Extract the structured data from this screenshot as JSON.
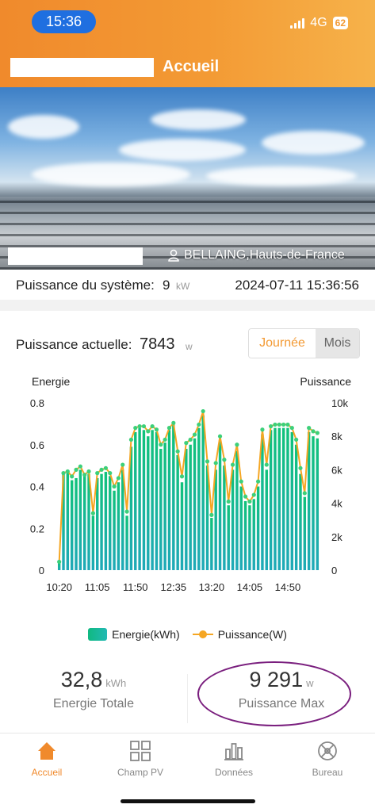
{
  "status_bar": {
    "time": "15:36",
    "network": "4G",
    "battery": "62"
  },
  "header": {
    "title": "Accueil"
  },
  "banner": {
    "location": "BELLAING,Hauts-de-France"
  },
  "system": {
    "label": "Puissance du système:",
    "value": "9",
    "unit": "kW",
    "datetime": "2024-07-11 15:36:56"
  },
  "current": {
    "label": "Puissance actuelle:",
    "value": "7843",
    "unit": "w"
  },
  "period_toggle": {
    "day": "Journée",
    "month": "Mois",
    "selected": "Journée"
  },
  "chart_data": {
    "type": "bar",
    "combo": "bar+line",
    "left_axis_title": "Energie",
    "right_axis_title": "Puissance",
    "left_ticks": [
      "0",
      "0.2",
      "0.4",
      "0.6",
      "0.8"
    ],
    "right_ticks": [
      "0",
      "2k",
      "4k",
      "6k",
      "8k",
      "10k"
    ],
    "left_ylim": [
      0,
      0.8
    ],
    "right_ylim": [
      0,
      10000
    ],
    "x_ticks": [
      "10:20",
      "11:05",
      "11:50",
      "12:35",
      "13:20",
      "14:05",
      "14:50"
    ],
    "series": [
      {
        "name": "Energie(kWh)",
        "axis": "left",
        "color": "#14b8a6",
        "values": [
          0.04,
          0.46,
          0.47,
          0.43,
          0.44,
          0.48,
          0.45,
          0.46,
          0.26,
          0.44,
          0.46,
          0.47,
          0.45,
          0.38,
          0.42,
          0.48,
          0.26,
          0.59,
          0.66,
          0.68,
          0.67,
          0.64,
          0.67,
          0.66,
          0.58,
          0.61,
          0.67,
          0.7,
          0.55,
          0.42,
          0.58,
          0.6,
          0.63,
          0.68,
          0.74,
          0.5,
          0.25,
          0.48,
          0.62,
          0.5,
          0.31,
          0.48,
          0.57,
          0.4,
          0.33,
          0.31,
          0.34,
          0.4,
          0.65,
          0.48,
          0.67,
          0.68,
          0.68,
          0.68,
          0.68,
          0.66,
          0.6,
          0.46,
          0.35,
          0.66,
          0.64,
          0.63
        ]
      },
      {
        "name": "Puissance(W)",
        "axis": "right",
        "color": "#f5a623",
        "values": [
          500,
          5800,
          5900,
          5600,
          6000,
          6200,
          5700,
          5900,
          3400,
          5800,
          6000,
          6100,
          5800,
          5000,
          5500,
          6300,
          3500,
          7800,
          8500,
          8600,
          8600,
          8300,
          8600,
          8400,
          7500,
          7800,
          8500,
          8800,
          7100,
          5600,
          7600,
          7800,
          8100,
          8700,
          9500,
          6500,
          3300,
          6400,
          8000,
          6600,
          4100,
          6300,
          7500,
          5300,
          4400,
          4100,
          4500,
          5300,
          8400,
          6300,
          8600,
          8700,
          8700,
          8700,
          8700,
          8500,
          7800,
          6100,
          4600,
          8500,
          8300,
          8200
        ]
      }
    ]
  },
  "stats": {
    "total_energy": {
      "value": "32,8",
      "unit": "kWh",
      "label": "Energie Totale"
    },
    "max_power": {
      "value": "9 291",
      "unit": "w",
      "label": "Puissance Max"
    }
  },
  "tabs": [
    {
      "label": "Accueil",
      "icon": "home-icon",
      "active": true
    },
    {
      "label": "Champ PV",
      "icon": "grid-icon",
      "active": false
    },
    {
      "label": "Données",
      "icon": "bar-chart-icon",
      "active": false
    },
    {
      "label": "Bureau",
      "icon": "compass-icon",
      "active": false
    }
  ],
  "colors": {
    "accent": "#f08a2c",
    "energy": "#14b8a6",
    "power": "#f5a623",
    "highlight_ring": "#7a1f7e"
  }
}
